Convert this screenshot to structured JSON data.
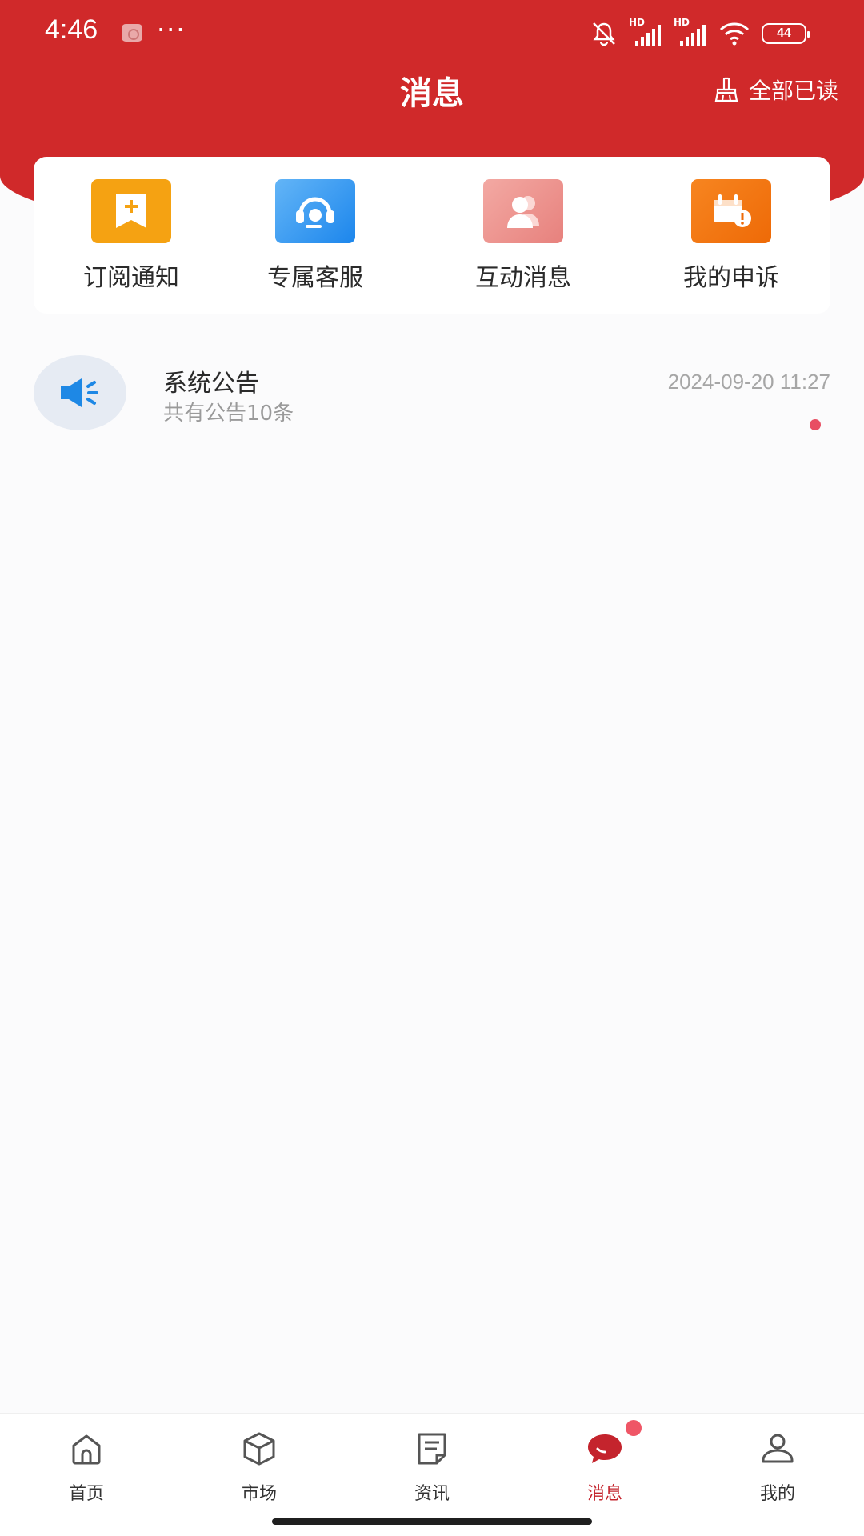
{
  "status_bar": {
    "time": "4:46",
    "dots": "···",
    "signal_1": "HD",
    "signal_2": "HD",
    "battery": "44"
  },
  "header": {
    "title": "消息",
    "mark_all_read": "全部已读"
  },
  "quick_entries": [
    {
      "label": "订阅通知",
      "icon": "bookmark-plus-icon",
      "color": "#f5a212"
    },
    {
      "label": "专属客服",
      "icon": "headset-icon",
      "color": "#3d99f0"
    },
    {
      "label": "互动消息",
      "icon": "users-icon",
      "color": "#ec8a86"
    },
    {
      "label": "我的申诉",
      "icon": "calendar-alert-icon",
      "color": "#f2760f"
    }
  ],
  "messages": [
    {
      "title": "系统公告",
      "subtitle": "共有公告10条",
      "time": "2024-09-20 11:27",
      "icon": "megaphone-icon",
      "unread": true
    }
  ],
  "bottom_nav": [
    {
      "label": "首页",
      "icon": "home-icon",
      "active": false
    },
    {
      "label": "市场",
      "icon": "box-icon",
      "active": false
    },
    {
      "label": "资讯",
      "icon": "document-icon",
      "active": false
    },
    {
      "label": "消息",
      "icon": "chat-icon",
      "active": true,
      "badge": true
    },
    {
      "label": "我的",
      "icon": "user-icon",
      "active": false
    }
  ],
  "colors": {
    "brand_red": "#d0292a",
    "active_red": "#c4242d",
    "badge": "#ef5666"
  }
}
